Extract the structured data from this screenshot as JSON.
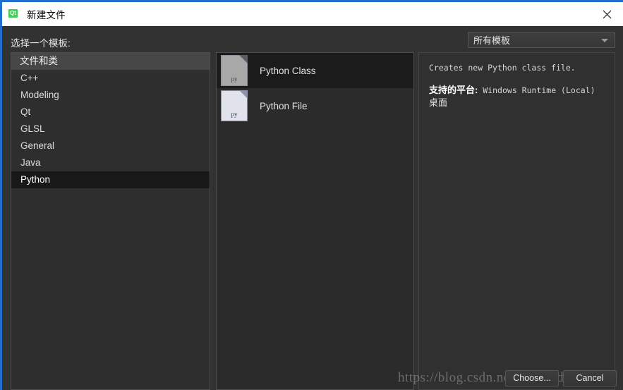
{
  "window": {
    "title": "新建文件",
    "logo_text": "Qt",
    "close_icon": "close-icon",
    "accent_color": "#1f6fd0",
    "background_color": "#323232"
  },
  "header": {
    "prompt_label": "选择一个模板:",
    "filter_combo": {
      "selected": "所有模板",
      "arrow_icon": "chevron-down-icon"
    }
  },
  "categories": {
    "header": "文件和类",
    "items": [
      {
        "label": "C++",
        "selected": false
      },
      {
        "label": "Modeling",
        "selected": false
      },
      {
        "label": "Qt",
        "selected": false
      },
      {
        "label": "GLSL",
        "selected": false
      },
      {
        "label": "General",
        "selected": false
      },
      {
        "label": "Java",
        "selected": false
      },
      {
        "label": "Python",
        "selected": true
      }
    ]
  },
  "templates": {
    "items": [
      {
        "label": "Python Class",
        "icon": "python-file-icon",
        "icon_ext": "py",
        "selected": true
      },
      {
        "label": "Python File",
        "icon": "python-file-icon",
        "icon_ext": "py",
        "selected": false
      }
    ]
  },
  "description": {
    "summary": "Creates new Python class file.",
    "platform_label": "支持的平台:",
    "platform_value": "Windows Runtime (Local)",
    "platform_second": "桌面"
  },
  "footer": {
    "choose_label": "Choose...",
    "cancel_label": "Cancel"
  },
  "watermark": {
    "text": "https://blog.csdn.net/alxxxxde"
  }
}
